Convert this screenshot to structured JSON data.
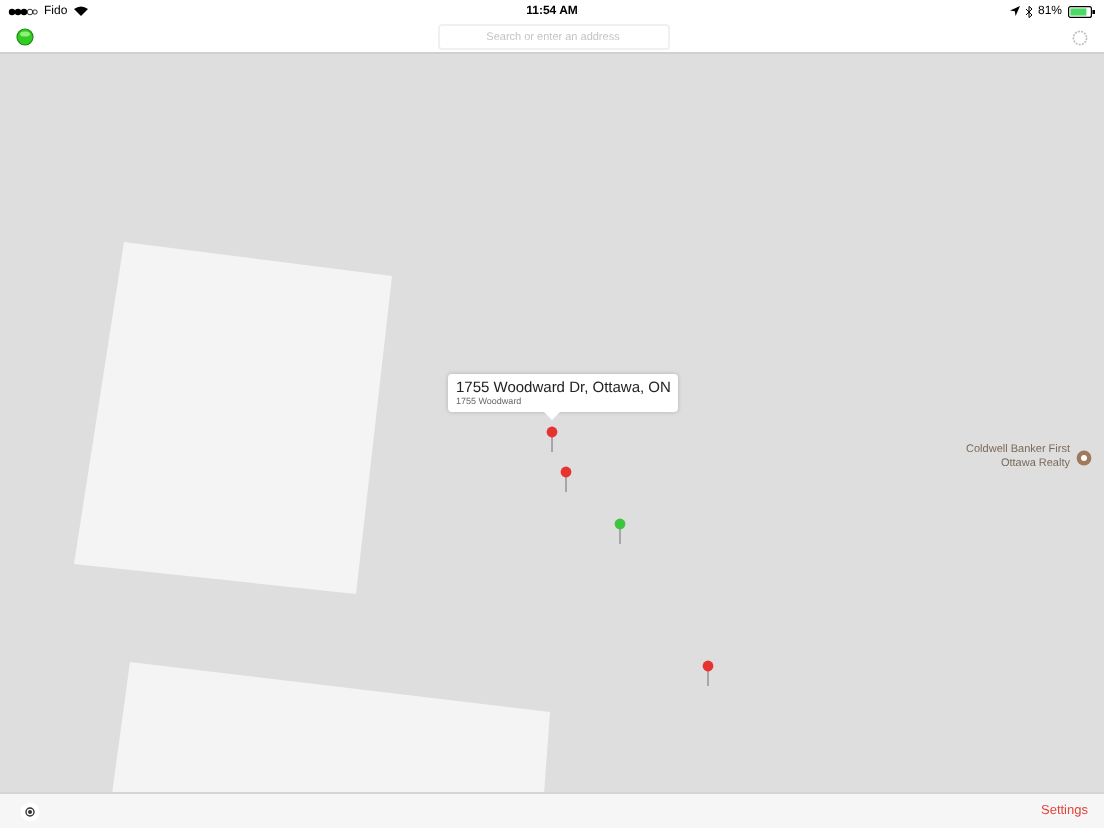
{
  "status_bar": {
    "carrier": "Fido",
    "time": "11:54 AM",
    "battery": "81%"
  },
  "toolbar": {
    "search": {
      "placeholder": "Search or enter an address"
    }
  },
  "map": {
    "callout": {
      "title": "1755 Woodward Dr, Ottawa, ON",
      "subtitle": "1755 Woodward"
    },
    "pins": [
      {
        "color": "#e8322f"
      },
      {
        "color": "#e8322f"
      },
      {
        "color": "#3ec43e"
      },
      {
        "color": "#e8322f"
      }
    ],
    "poi": {
      "label": "Coldwell Banker First Ottawa Realty"
    }
  },
  "bottom_bar": {
    "settings": "Settings"
  }
}
